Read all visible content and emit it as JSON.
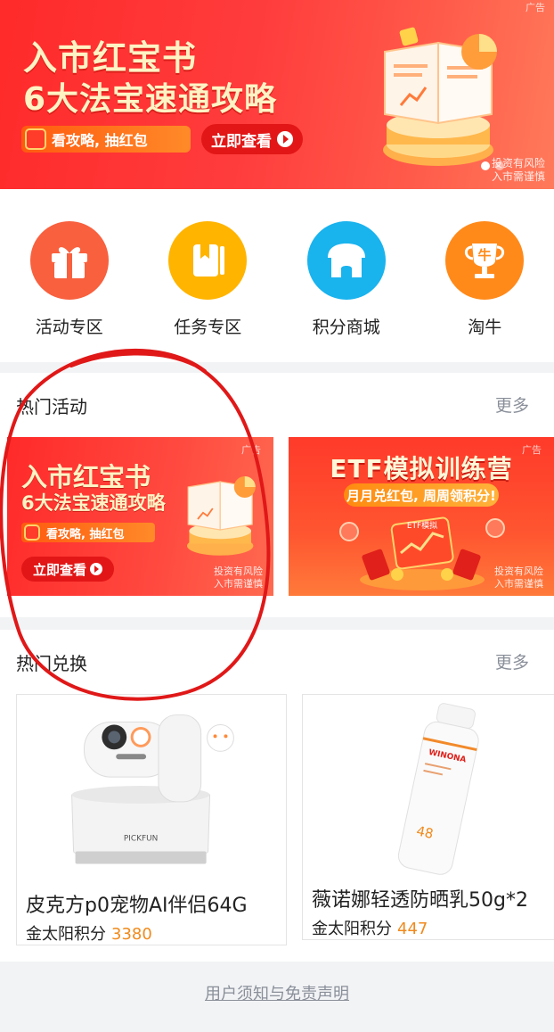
{
  "top_banner": {
    "ad_tag": "广告",
    "title_line1": "入市红宝书",
    "title_line2": "6大法宝速通攻略",
    "promo_pill": "看攻略, 抽红包",
    "cta_button": "立即查看",
    "risk_line1": "投资有风险",
    "risk_line2": "入市需谨慎",
    "carousel_count": 2,
    "carousel_active": 1
  },
  "quick_links": [
    {
      "label": "活动专区",
      "icon": "gift-icon",
      "color": "#f8603e"
    },
    {
      "label": "任务专区",
      "icon": "book-icon",
      "color": "#ffb400"
    },
    {
      "label": "积分商城",
      "icon": "store-icon",
      "color": "#19b3ee"
    },
    {
      "label": "淘牛",
      "icon": "trophy-icon",
      "color": "#ff8a1a",
      "trophy_char": "牛"
    }
  ],
  "hot_activities": {
    "title": "热门活动",
    "more": "更多",
    "cards": [
      {
        "ad_tag": "广告",
        "title_line1": "入市红宝书",
        "title_line2": "6大法宝速通攻略",
        "promo_pill": "看攻略, 抽红包",
        "cta_button": "立即查看",
        "risk_line1": "投资有风险",
        "risk_line2": "入市需谨慎"
      },
      {
        "ad_tag": "广告",
        "title": "ETF模拟训练营",
        "subtitle": "月月兑红包, 周周领积分!",
        "risk_line1": "投资有风险",
        "risk_line2": "入市需谨慎",
        "badge_text": "ETF模拟"
      }
    ]
  },
  "hot_exchange": {
    "title": "热门兑换",
    "more": "更多",
    "points_label": "金太阳积分",
    "products": [
      {
        "name": "皮克方p0宠物AI伴侣64G",
        "points": "3380",
        "brand_text": "PICKFUN"
      },
      {
        "name": "薇诺娜轻透防晒乳50g*2",
        "points": "447",
        "brand_text": "WINONA",
        "spf_text": "48"
      }
    ]
  },
  "footer": {
    "link": "用户须知与免责声明"
  },
  "colors": {
    "accent_red": "#ff2a2a",
    "points_orange": "#f08a1c",
    "muted_gray": "#8a8f99",
    "annotation_red": "#e01818"
  }
}
